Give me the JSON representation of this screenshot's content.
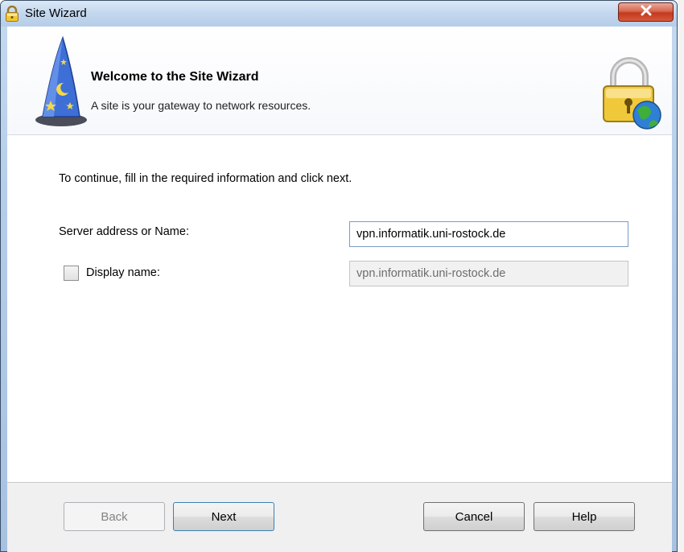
{
  "window": {
    "title": "Site Wizard",
    "icons": {
      "title": "padlock-icon",
      "close": "close-icon"
    }
  },
  "header": {
    "title": "Welcome to the Site Wizard",
    "subtitle": "A site is your gateway to network resources.",
    "icons": {
      "left": "wizard-hat-icon",
      "right": "lock-globe-icon"
    }
  },
  "form": {
    "instructions": "To continue, fill in the required information and click next.",
    "server_label": "Server address or Name:",
    "server_value": "vpn.informatik.uni-rostock.de",
    "display_label": "Display name:",
    "display_checked": false,
    "display_value": "vpn.informatik.uni-rostock.de"
  },
  "footer": {
    "back_label": "Back",
    "next_label": "Next",
    "cancel_label": "Cancel",
    "help_label": "Help"
  },
  "colors": {
    "titlebar": "#c3d7ee",
    "close_button": "#c23a1e",
    "footer": "#f0f0f0",
    "disabled_text": "#838383"
  }
}
